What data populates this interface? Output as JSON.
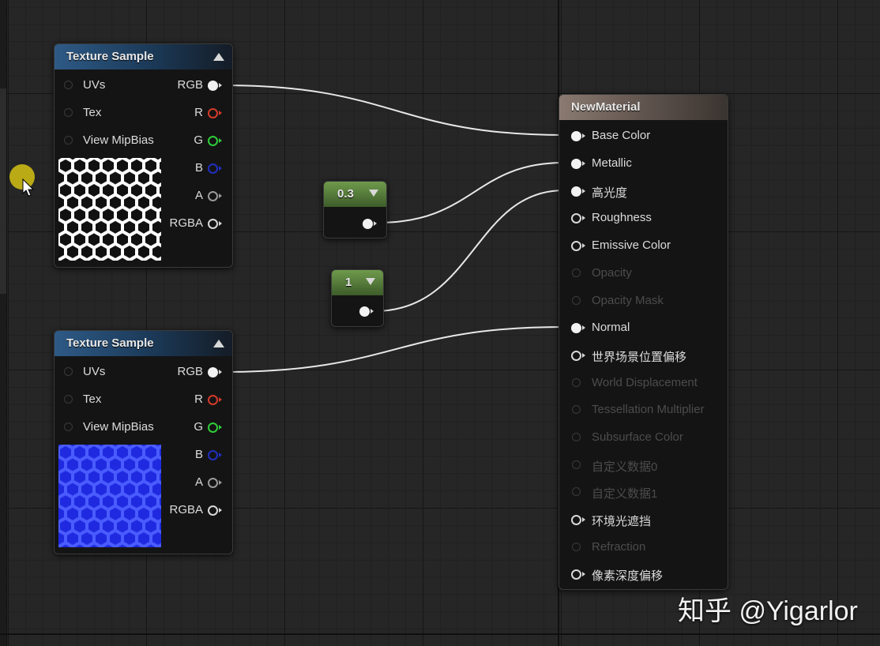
{
  "texture_sample_1": {
    "title": "Texture Sample",
    "inputs": [
      "UVs",
      "Tex",
      "View MipBias"
    ],
    "outputs": [
      "RGB",
      "R",
      "G",
      "B",
      "A",
      "RGBA"
    ]
  },
  "texture_sample_2": {
    "title": "Texture Sample",
    "inputs": [
      "UVs",
      "Tex",
      "View MipBias"
    ],
    "outputs": [
      "RGB",
      "R",
      "G",
      "B",
      "A",
      "RGBA"
    ]
  },
  "constant_1": {
    "value": "0.3"
  },
  "constant_2": {
    "value": "1"
  },
  "material": {
    "title": "NewMaterial",
    "inputs": [
      "Base Color",
      "Metallic",
      "高光度",
      "Roughness",
      "Emissive Color",
      "Opacity",
      "Opacity Mask",
      "Normal",
      "世界场景位置偏移",
      "World Displacement",
      "Tessellation Multiplier",
      "Subsurface Color",
      "自定义数据0",
      "自定义数据1",
      "环境光遮挡",
      "Refraction",
      "像素深度偏移"
    ]
  },
  "pin_colors": {
    "R": "#d43b2a",
    "G": "#2fcd3a",
    "B": "#1f2fbf",
    "wire": "#e8e8e8"
  },
  "watermark": "知乎 @Yigarlor"
}
